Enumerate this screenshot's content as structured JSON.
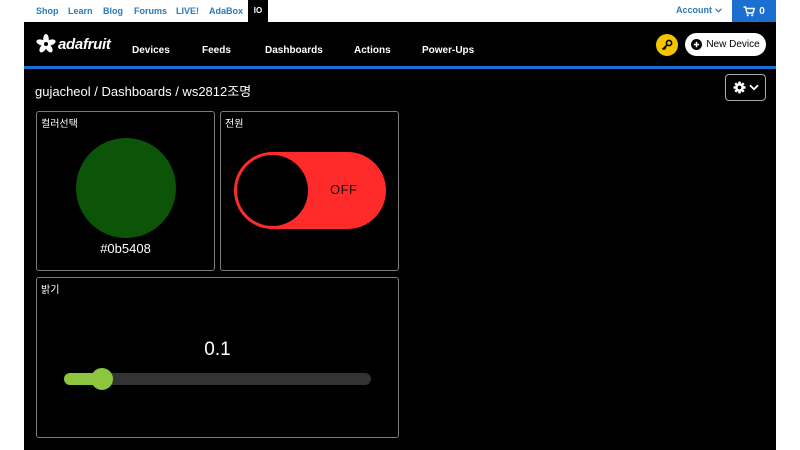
{
  "topbar": {
    "links": [
      "Shop",
      "Learn",
      "Blog",
      "Forums",
      "LIVE!",
      "AdaBox"
    ],
    "active_tab": "IO",
    "account_label": "Account",
    "cart_count": "0"
  },
  "nav": {
    "brand": "adafruit",
    "items": [
      "Devices",
      "Feeds",
      "Dashboards",
      "Actions",
      "Power-Ups"
    ],
    "new_device_label": "New Device"
  },
  "breadcrumb": "gujacheol / Dashboards / ws2812조명",
  "blocks": {
    "color": {
      "title": "컬러선택",
      "hex": "#0b5408",
      "color": "#0b5408"
    },
    "power": {
      "title": "전원",
      "state": "OFF",
      "on_color": "#ff2b2b"
    },
    "brightness": {
      "title": "밝기",
      "value": "0.1",
      "fraction": 0.1,
      "accent": "#8cc63f"
    }
  },
  "colors": {
    "accent_blue": "#1b6fd1",
    "link_blue": "#2a7ab8",
    "key_yellow": "#f5c400"
  }
}
